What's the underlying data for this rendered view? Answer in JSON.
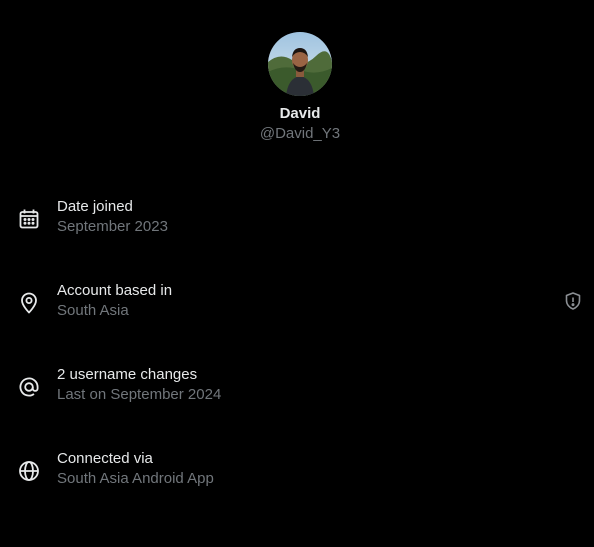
{
  "profile": {
    "display_name": "David",
    "handle": "@David_Y3",
    "avatar_icon": "avatar-photo"
  },
  "details": [
    {
      "icon": "calendar-icon",
      "title": "Date joined",
      "value": "September 2023"
    },
    {
      "icon": "location-pin-icon",
      "title": "Account based in",
      "value": "South Asia",
      "trailing_icon": "shield-alert-icon"
    },
    {
      "icon": "at-sign-icon",
      "title": "2 username changes",
      "value": "Last on September 2024"
    },
    {
      "icon": "globe-icon",
      "title": "Connected via",
      "value": "South Asia Android App"
    }
  ],
  "colors": {
    "background": "#000000",
    "primary_text": "#e7e9ea",
    "secondary_text": "#71767b"
  }
}
